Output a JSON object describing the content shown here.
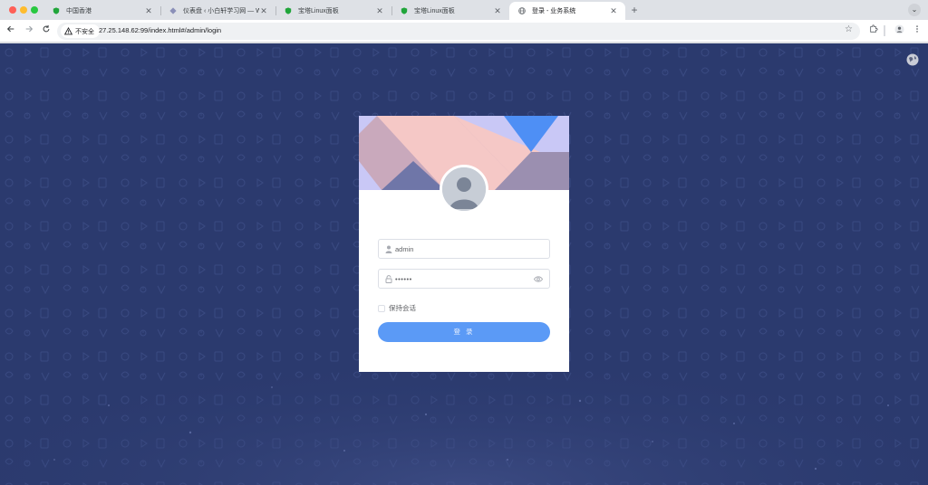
{
  "browser": {
    "tabs": [
      {
        "title": "中国香港",
        "active": false,
        "favicon": "shield-green-icon"
      },
      {
        "title": "仪表盘 ‹ 小白轩学习网 — Word",
        "active": false,
        "favicon": "wordpress-diamond-icon"
      },
      {
        "title": "宝塔Linux面板",
        "active": false,
        "favicon": "shield-green-icon"
      },
      {
        "title": "宝塔Linux面板",
        "active": false,
        "favicon": "shield-green-icon"
      },
      {
        "title": "登录 - 业务系统",
        "active": true,
        "favicon": "globe-icon"
      }
    ],
    "new_tab_symbol": "+",
    "tab_menu_symbol": "⌄",
    "close_symbol": "✕",
    "address": {
      "security_label": "不安全",
      "url": "27.25.148.62:99/index.html#/admin/login"
    }
  },
  "login": {
    "username_value": "admin",
    "password_value": "••••••",
    "remember_label": "保持会话",
    "remember_checked": false,
    "submit_label": "登 录"
  },
  "colors": {
    "page_background": "#2b3a6e",
    "button": "#5b9af6",
    "banner_pink": "#f5c8c6",
    "banner_lavender": "#c9c8f6",
    "banner_blue": "#4e8ff5",
    "banner_mauve": "#9b8fb0",
    "banner_slate": "#6f76a8"
  }
}
